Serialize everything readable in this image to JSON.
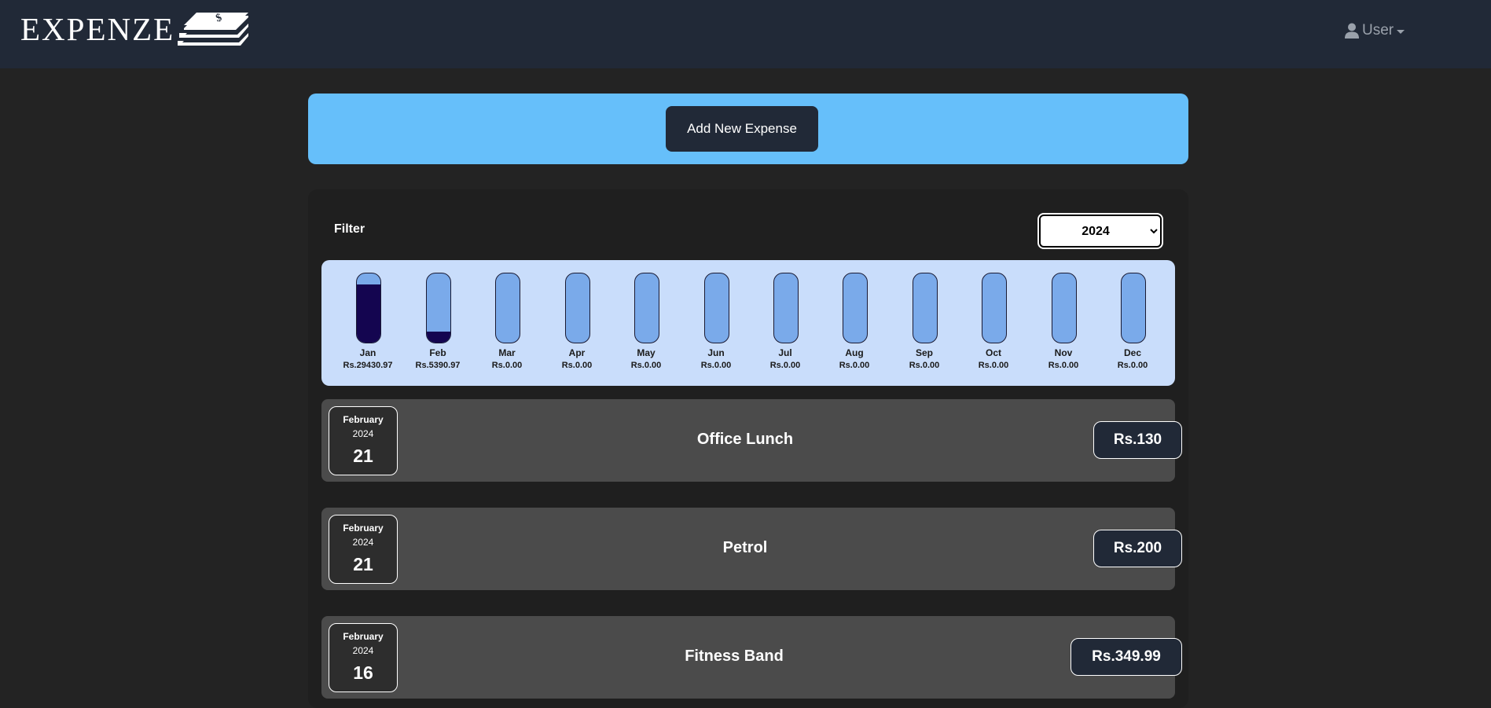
{
  "navbar": {
    "brand": "EXPENZE",
    "user_label": "User"
  },
  "new_expense": {
    "button_label": "Add New Expense"
  },
  "expenses": {
    "filter_label": "Filter",
    "selected_year": "2024",
    "year_options": [
      "2024"
    ],
    "chart_data": {
      "type": "bar",
      "categories": [
        "Jan",
        "Feb",
        "Mar",
        "Apr",
        "May",
        "Jun",
        "Jul",
        "Aug",
        "Sep",
        "Oct",
        "Nov",
        "Dec"
      ],
      "values": [
        29430.97,
        5390.97,
        0,
        0,
        0,
        0,
        0,
        0,
        0,
        0,
        0,
        0
      ],
      "value_labels": [
        "Rs.29430.97",
        "Rs.5390.97",
        "Rs.0.00",
        "Rs.0.00",
        "Rs.0.00",
        "Rs.0.00",
        "Rs.0.00",
        "Rs.0.00",
        "Rs.0.00",
        "Rs.0.00",
        "Rs.0.00",
        "Rs.0.00"
      ],
      "max": 34821.94,
      "colors": {
        "track": "#7aaaea",
        "fill": "#140550",
        "background": "#c9ddfb"
      }
    },
    "items": [
      {
        "month": "February",
        "year": "2024",
        "day": "21",
        "title": "Office Lunch",
        "amount": "Rs.130"
      },
      {
        "month": "February",
        "year": "2024",
        "day": "21",
        "title": "Petrol",
        "amount": "Rs.200"
      },
      {
        "month": "February",
        "year": "2024",
        "day": "16",
        "title": "Fitness Band",
        "amount": "Rs.349.99"
      }
    ]
  },
  "colors": {
    "navbar": "#212937",
    "page_background": "#232323",
    "new_expense_panel": "#66bffa",
    "expense_item": "#4b4b4b"
  }
}
